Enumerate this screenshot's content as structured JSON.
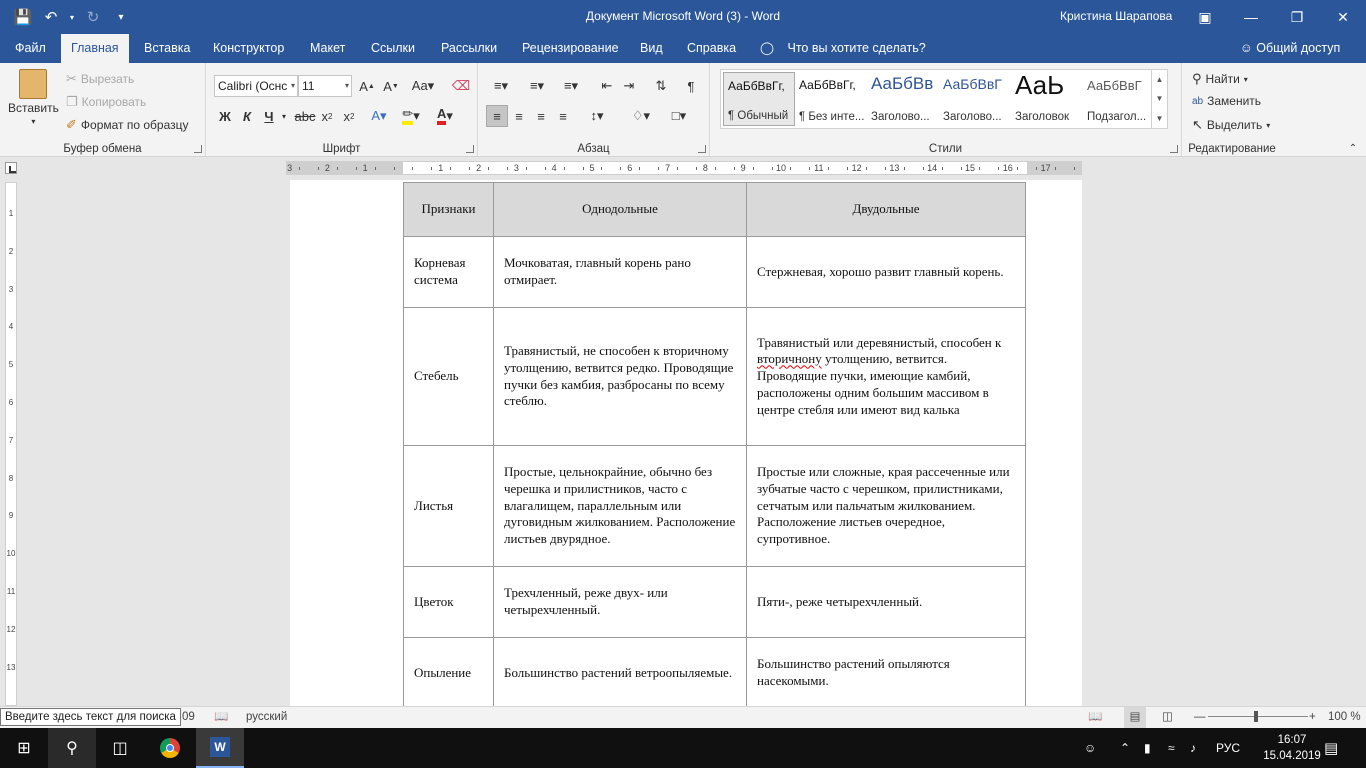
{
  "window": {
    "title": "Документ Microsoft Word (3)  -  Word",
    "user": "Кристина Шарапова"
  },
  "tabs": [
    {
      "label": "Файл"
    },
    {
      "label": "Главная"
    },
    {
      "label": "Вставка"
    },
    {
      "label": "Конструктор"
    },
    {
      "label": "Макет"
    },
    {
      "label": "Ссылки"
    },
    {
      "label": "Рассылки"
    },
    {
      "label": "Рецензирование"
    },
    {
      "label": "Вид"
    },
    {
      "label": "Справка"
    }
  ],
  "tell_me": "Что вы хотите сделать?",
  "share": "Общий доступ",
  "clipboard": {
    "paste": "Вставить",
    "cut": "Вырезать",
    "copy": "Копировать",
    "format_painter": "Формат по образцу",
    "label": "Буфер обмена"
  },
  "font": {
    "name": "Calibri (Оснс",
    "size": "11",
    "bold": "Ж",
    "italic": "К",
    "underline": "Ч",
    "label": "Шрифт"
  },
  "paragraph": {
    "label": "Абзац"
  },
  "styles": {
    "label": "Стили",
    "items": [
      {
        "preview": "АаБбВвГг,",
        "name": "¶ Обычный"
      },
      {
        "preview": "АаБбВвГг,",
        "name": "¶ Без инте..."
      },
      {
        "preview": "АаБбВв",
        "name": "Заголово..."
      },
      {
        "preview": "АаБбВвГ",
        "name": "Заголово..."
      },
      {
        "preview": "АаЬ",
        "name": "Заголовок"
      },
      {
        "preview": "АаБбВвГ",
        "name": "Подзагол..."
      }
    ]
  },
  "editing": {
    "find": "Найти",
    "replace": "Заменить",
    "select": "Выделить",
    "label": "Редактирование"
  },
  "ruler_numbers": [
    "3",
    "2",
    "1",
    "1",
    "2",
    "3",
    "4",
    "5",
    "6",
    "7",
    "8",
    "9",
    "10",
    "11",
    "12",
    "13",
    "14",
    "15",
    "16",
    "17"
  ],
  "vruler_numbers": [
    "1",
    "2",
    "3",
    "4",
    "5",
    "6",
    "7",
    "8",
    "9",
    "10",
    "11",
    "12",
    "13"
  ],
  "table": {
    "headers": [
      "Признаки",
      "Однодольные",
      "Двудольные"
    ],
    "rows": [
      {
        "feature": "Корневая система",
        "mono": "Мочковатая, главный корень рано отмирает.",
        "di": "Стержневая, хорошо развит главный корень."
      },
      {
        "feature": "Стебель",
        "mono": "Травянистый, не способен к вторичному утолщению, ветвится редко. Проводящие пучки без камбия, разбросаны по всему стеблю.",
        "di_a": "Травянистый или деревянистый, способен к ",
        "di_err": "вторичнону",
        "di_b": " утолщению, ветвится. Проводящие пучки, имеющие камбий, расположены одним большим массивом в центре стебля или имеют вид калька"
      },
      {
        "feature": "Листья",
        "mono": "Простые, цельнокрайние, обычно без черешка и прилистников, часто с влагалищем, параллельным или дуговидным жилкованием. Расположение листьев двурядное.",
        "di": "Простые или сложные, края рассеченные или зубчатые часто с черешком, прилистниками, сетчатым или пальчатым жилкованием. Расположение листьев очередное, супротивное."
      },
      {
        "feature": "Цветок",
        "mono": "Трехчленный, реже двух- или четырехчленный.",
        "di": "Пяти-, реже четырехчленный."
      },
      {
        "feature": "Опыление",
        "mono": "Большинство растений ветроопыляемые.",
        "di": "Большинство растений опыляются насекомыми."
      }
    ]
  },
  "status": {
    "tooltip": "Введите здесь текст для поиска",
    "words": "09",
    "language": "русский",
    "zoom": "100 %"
  },
  "taskbar": {
    "lang": "РУС",
    "time": "16:07",
    "date": "15.04.2019"
  }
}
